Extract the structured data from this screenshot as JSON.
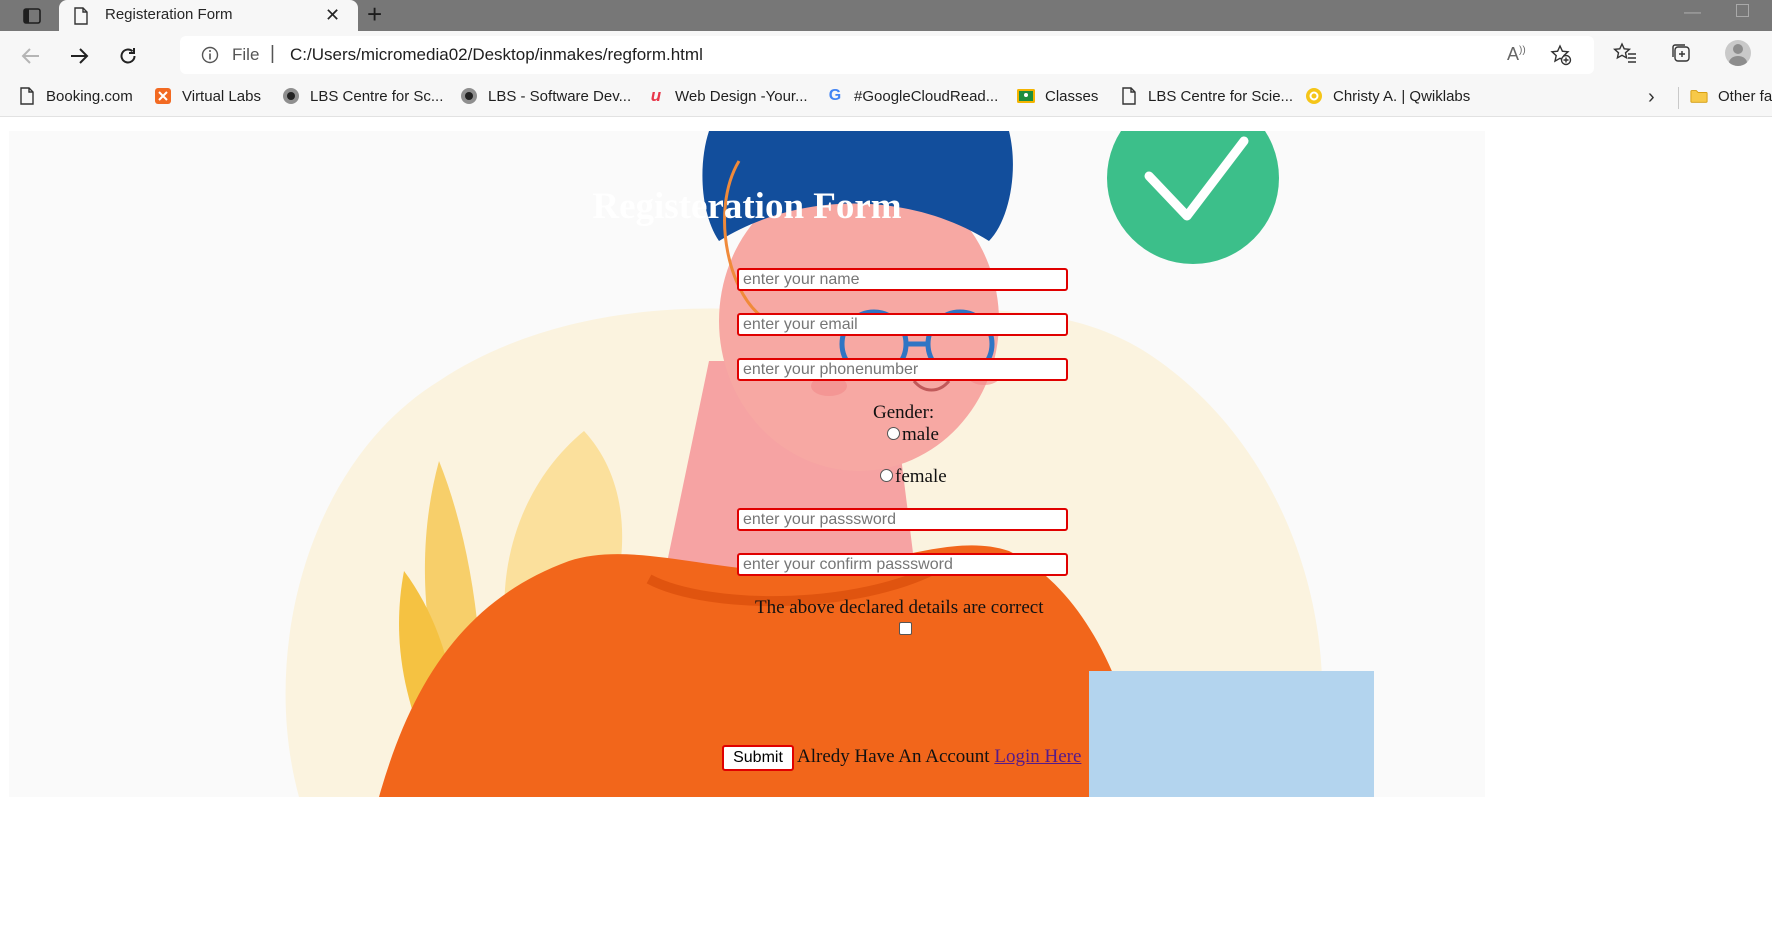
{
  "browser": {
    "tab": {
      "title": "Registeration Form"
    },
    "address": {
      "scheme_label": "File",
      "separator": "|",
      "url": "C:/Users/micromedia02/Desktop/inmakes/regform.html"
    },
    "bookmarks": [
      {
        "label": "Booking.com",
        "icon": "page-icon"
      },
      {
        "label": "Virtual Labs",
        "icon": "virtual-labs-icon"
      },
      {
        "label": "LBS Centre for Sc...",
        "icon": "lbs-icon"
      },
      {
        "label": "LBS - Software Dev...",
        "icon": "lbs-icon"
      },
      {
        "label": "Web Design -Your...",
        "icon": "webdesign-icon"
      },
      {
        "label": "#GoogleCloudRead...",
        "icon": "google-icon"
      },
      {
        "label": "Classes",
        "icon": "classroom-icon"
      },
      {
        "label": "LBS Centre for Scie...",
        "icon": "page-icon"
      },
      {
        "label": "Christy A. | Qwiklabs",
        "icon": "qwiklabs-icon"
      }
    ],
    "other_favorites": "Other fa"
  },
  "form": {
    "title": "Registeration Form",
    "name_placeholder": "enter your name",
    "email_placeholder": "enter your email",
    "phone_placeholder": "enter your phonenumber",
    "gender_label": "Gender:",
    "gender_options": [
      "male",
      "female"
    ],
    "password_placeholder": "enter your passsword",
    "confirm_placeholder": "enter your confirm passsword",
    "declaration": "The above declared details are correct",
    "submit_label": "Submit",
    "account_text": "Alredy Have An Account",
    "login_link": "Login Here"
  },
  "colors": {
    "field_border": "#e00000",
    "title_text": "#ffffff",
    "shirt": "#f2661b",
    "hair": "#124e9c",
    "badge": "#3cbf8a"
  }
}
